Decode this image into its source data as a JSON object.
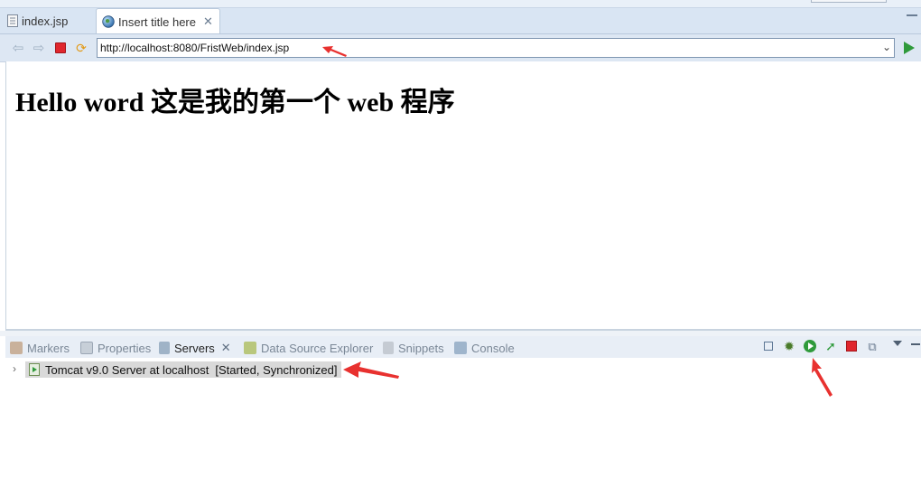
{
  "editor_tabs": [
    {
      "label": "index.jsp",
      "icon": "jsp-file-icon",
      "active": false
    },
    {
      "label": "Insert title here",
      "icon": "globe-icon",
      "active": true
    }
  ],
  "browser": {
    "url": "http://localhost:8080/FristWeb/index.jsp",
    "heading": "Hello word 这是我的第一个 web 程序"
  },
  "bottom_panel": {
    "tabs": [
      {
        "label": "Markers",
        "icon": "markers-icon",
        "active": false
      },
      {
        "label": "Properties",
        "icon": "properties-icon",
        "active": false
      },
      {
        "label": "Servers",
        "icon": "servers-icon",
        "active": true
      },
      {
        "label": "Data Source Explorer",
        "icon": "data-source-icon",
        "active": false
      },
      {
        "label": "Snippets",
        "icon": "snippets-icon",
        "active": false
      },
      {
        "label": "Console",
        "icon": "console-icon",
        "active": false
      }
    ],
    "servers": [
      {
        "name": "Tomcat v9.0 Server at localhost",
        "status": "[Started, Synchronized]"
      }
    ]
  },
  "colors": {
    "annotation_arrow": "#e8312f",
    "start_button": "#2f9a3b",
    "stop_button": "#e0262d"
  }
}
